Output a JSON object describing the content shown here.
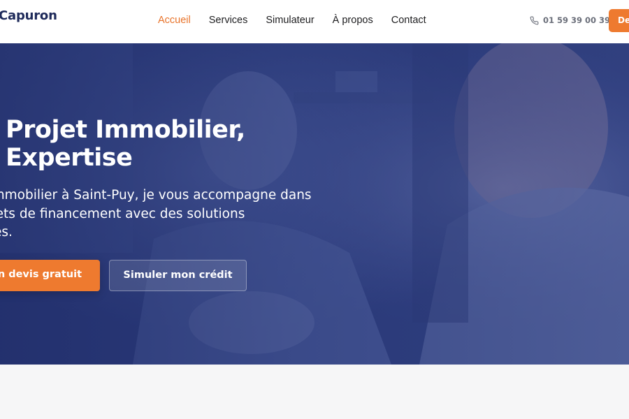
{
  "header": {
    "logo": "Capuron",
    "nav": [
      {
        "label": "Accueil",
        "active": true
      },
      {
        "label": "Services",
        "active": false
      },
      {
        "label": "Simulateur",
        "active": false
      },
      {
        "label": "À propos",
        "active": false
      },
      {
        "label": "Contact",
        "active": false
      }
    ],
    "phone": "01 59 39 00 39",
    "phone_icon": "phone-icon",
    "cta_label": "De"
  },
  "hero": {
    "title_line1": "Projet Immobilier,",
    "title_line2": "Expertise",
    "subtitle_line1": "r immobilier à Saint-Puy, je vous accompagne dans",
    "subtitle_line2": "rojets de financement avec des solutions",
    "subtitle_line3": "sées.",
    "primary_button": "un devis gratuit",
    "secondary_button": "Simuler mon crédit"
  },
  "colors": {
    "accent": "#ee7a2f",
    "brand_dark": "#1e2a5a",
    "hero_overlay": "#2e3f7e"
  }
}
